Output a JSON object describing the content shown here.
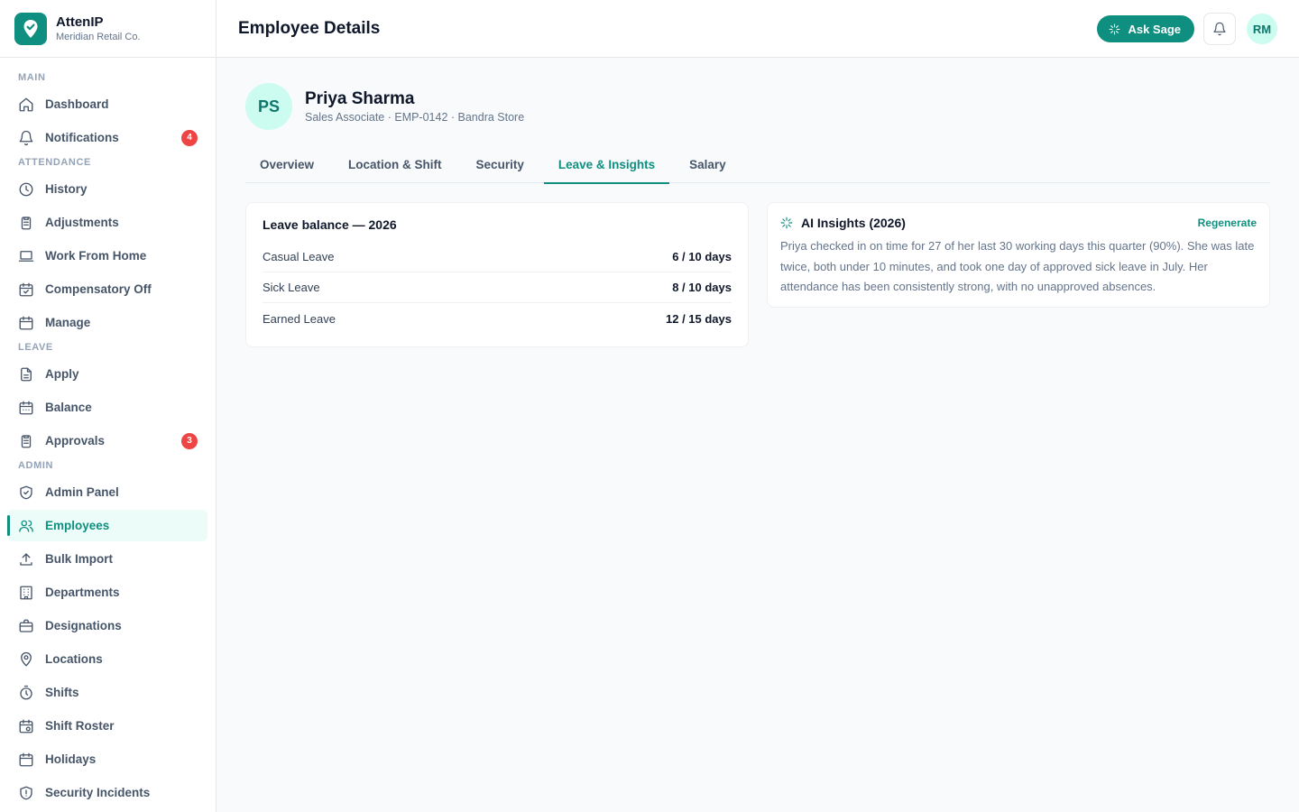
{
  "brand": {
    "name": "AttenIP",
    "org": "Meridian Retail Co."
  },
  "sidebar": {
    "sections": [
      {
        "label": "MAIN",
        "items": [
          {
            "label": "Dashboard",
            "icon": "home-icon"
          },
          {
            "label": "Notifications",
            "icon": "bell-icon",
            "badge": "4"
          }
        ]
      },
      {
        "label": "ATTENDANCE",
        "items": [
          {
            "label": "History",
            "icon": "clock-icon"
          },
          {
            "label": "Adjustments",
            "icon": "clipboard-icon"
          },
          {
            "label": "Work From Home",
            "icon": "laptop-icon"
          },
          {
            "label": "Compensatory Off",
            "icon": "calendar-check-icon"
          },
          {
            "label": "Manage",
            "icon": "calendar-icon"
          }
        ]
      },
      {
        "label": "LEAVE",
        "items": [
          {
            "label": "Apply",
            "icon": "file-icon"
          },
          {
            "label": "Balance",
            "icon": "calendar-grid-icon"
          },
          {
            "label": "Approvals",
            "icon": "clipboard-icon",
            "badge": "3"
          }
        ]
      },
      {
        "label": "ADMIN",
        "items": [
          {
            "label": "Admin Panel",
            "icon": "shield-check-icon"
          },
          {
            "label": "Employees",
            "icon": "users-icon",
            "active": true
          },
          {
            "label": "Bulk Import",
            "icon": "upload-icon"
          },
          {
            "label": "Departments",
            "icon": "building-icon"
          },
          {
            "label": "Designations",
            "icon": "briefcase-icon"
          },
          {
            "label": "Locations",
            "icon": "map-pin-icon"
          },
          {
            "label": "Shifts",
            "icon": "stopwatch-icon"
          },
          {
            "label": "Shift Roster",
            "icon": "calendar-clock-icon"
          },
          {
            "label": "Holidays",
            "icon": "calendar-icon"
          },
          {
            "label": "Security Incidents",
            "icon": "shield-alert-icon"
          }
        ]
      }
    ]
  },
  "header": {
    "title": "Employee Details",
    "ask_label": "Ask Sage",
    "user_initials": "RM"
  },
  "employee": {
    "initials": "PS",
    "name": "Priya Sharma",
    "subtitle": "Sales Associate · EMP-0142 · Bandra Store"
  },
  "tabs": [
    {
      "label": "Overview",
      "active": false
    },
    {
      "label": "Location & Shift",
      "active": false
    },
    {
      "label": "Security",
      "active": false
    },
    {
      "label": "Leave & Insights",
      "active": true
    },
    {
      "label": "Salary",
      "active": false
    }
  ],
  "leave_balance": {
    "title": "Leave balance — 2026",
    "rows": [
      {
        "type": "Casual Leave",
        "value": "6 / 10 days"
      },
      {
        "type": "Sick Leave",
        "value": "8 / 10 days"
      },
      {
        "type": "Earned Leave",
        "value": "12 / 15 days"
      }
    ]
  },
  "ai_insights": {
    "title": "AI Insights (2026)",
    "regenerate_label": "Regenerate",
    "text": "Priya checked in on time for 27 of her last 30 working days this quarter (90%). She was late twice, both under 10 minutes, and took one day of approved sick leave in July. Her attendance has been consistently strong, with no unapproved absences."
  },
  "colors": {
    "accent": "#0f8f7f",
    "badge": "#ef4444",
    "avatar_bg": "#ccfbef"
  }
}
